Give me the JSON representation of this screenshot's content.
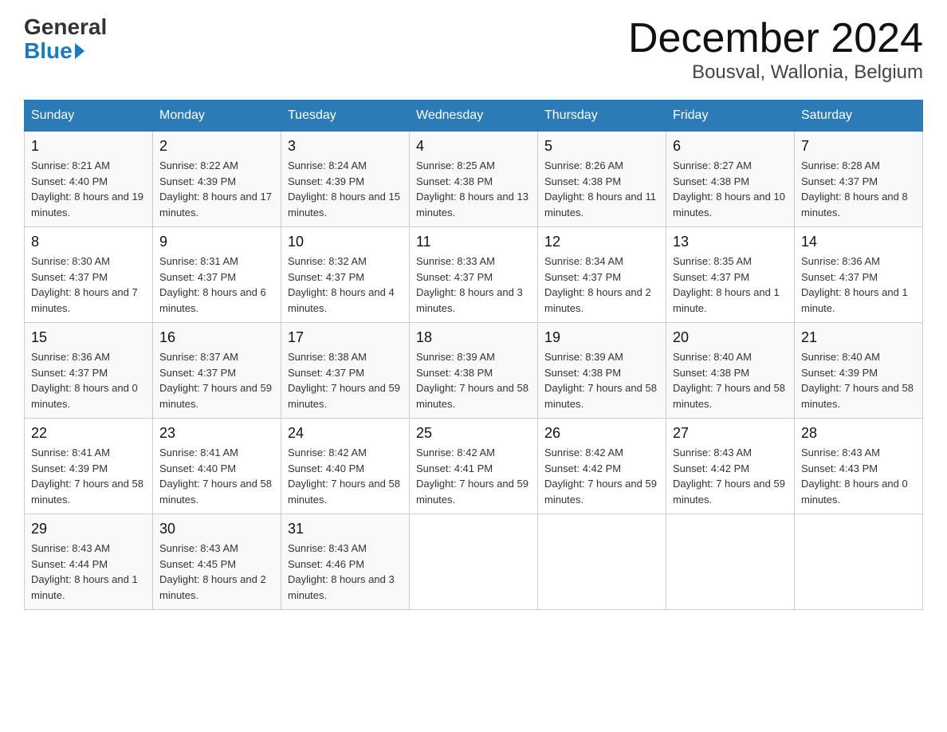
{
  "logo": {
    "general": "General",
    "blue": "Blue"
  },
  "header": {
    "month": "December 2024",
    "location": "Bousval, Wallonia, Belgium"
  },
  "days_of_week": [
    "Sunday",
    "Monday",
    "Tuesday",
    "Wednesday",
    "Thursday",
    "Friday",
    "Saturday"
  ],
  "weeks": [
    [
      {
        "day": "1",
        "sunrise": "8:21 AM",
        "sunset": "4:40 PM",
        "daylight": "8 hours and 19 minutes."
      },
      {
        "day": "2",
        "sunrise": "8:22 AM",
        "sunset": "4:39 PM",
        "daylight": "8 hours and 17 minutes."
      },
      {
        "day": "3",
        "sunrise": "8:24 AM",
        "sunset": "4:39 PM",
        "daylight": "8 hours and 15 minutes."
      },
      {
        "day": "4",
        "sunrise": "8:25 AM",
        "sunset": "4:38 PM",
        "daylight": "8 hours and 13 minutes."
      },
      {
        "day": "5",
        "sunrise": "8:26 AM",
        "sunset": "4:38 PM",
        "daylight": "8 hours and 11 minutes."
      },
      {
        "day": "6",
        "sunrise": "8:27 AM",
        "sunset": "4:38 PM",
        "daylight": "8 hours and 10 minutes."
      },
      {
        "day": "7",
        "sunrise": "8:28 AM",
        "sunset": "4:37 PM",
        "daylight": "8 hours and 8 minutes."
      }
    ],
    [
      {
        "day": "8",
        "sunrise": "8:30 AM",
        "sunset": "4:37 PM",
        "daylight": "8 hours and 7 minutes."
      },
      {
        "day": "9",
        "sunrise": "8:31 AM",
        "sunset": "4:37 PM",
        "daylight": "8 hours and 6 minutes."
      },
      {
        "day": "10",
        "sunrise": "8:32 AM",
        "sunset": "4:37 PM",
        "daylight": "8 hours and 4 minutes."
      },
      {
        "day": "11",
        "sunrise": "8:33 AM",
        "sunset": "4:37 PM",
        "daylight": "8 hours and 3 minutes."
      },
      {
        "day": "12",
        "sunrise": "8:34 AM",
        "sunset": "4:37 PM",
        "daylight": "8 hours and 2 minutes."
      },
      {
        "day": "13",
        "sunrise": "8:35 AM",
        "sunset": "4:37 PM",
        "daylight": "8 hours and 1 minute."
      },
      {
        "day": "14",
        "sunrise": "8:36 AM",
        "sunset": "4:37 PM",
        "daylight": "8 hours and 1 minute."
      }
    ],
    [
      {
        "day": "15",
        "sunrise": "8:36 AM",
        "sunset": "4:37 PM",
        "daylight": "8 hours and 0 minutes."
      },
      {
        "day": "16",
        "sunrise": "8:37 AM",
        "sunset": "4:37 PM",
        "daylight": "7 hours and 59 minutes."
      },
      {
        "day": "17",
        "sunrise": "8:38 AM",
        "sunset": "4:37 PM",
        "daylight": "7 hours and 59 minutes."
      },
      {
        "day": "18",
        "sunrise": "8:39 AM",
        "sunset": "4:38 PM",
        "daylight": "7 hours and 58 minutes."
      },
      {
        "day": "19",
        "sunrise": "8:39 AM",
        "sunset": "4:38 PM",
        "daylight": "7 hours and 58 minutes."
      },
      {
        "day": "20",
        "sunrise": "8:40 AM",
        "sunset": "4:38 PM",
        "daylight": "7 hours and 58 minutes."
      },
      {
        "day": "21",
        "sunrise": "8:40 AM",
        "sunset": "4:39 PM",
        "daylight": "7 hours and 58 minutes."
      }
    ],
    [
      {
        "day": "22",
        "sunrise": "8:41 AM",
        "sunset": "4:39 PM",
        "daylight": "7 hours and 58 minutes."
      },
      {
        "day": "23",
        "sunrise": "8:41 AM",
        "sunset": "4:40 PM",
        "daylight": "7 hours and 58 minutes."
      },
      {
        "day": "24",
        "sunrise": "8:42 AM",
        "sunset": "4:40 PM",
        "daylight": "7 hours and 58 minutes."
      },
      {
        "day": "25",
        "sunrise": "8:42 AM",
        "sunset": "4:41 PM",
        "daylight": "7 hours and 59 minutes."
      },
      {
        "day": "26",
        "sunrise": "8:42 AM",
        "sunset": "4:42 PM",
        "daylight": "7 hours and 59 minutes."
      },
      {
        "day": "27",
        "sunrise": "8:43 AM",
        "sunset": "4:42 PM",
        "daylight": "7 hours and 59 minutes."
      },
      {
        "day": "28",
        "sunrise": "8:43 AM",
        "sunset": "4:43 PM",
        "daylight": "8 hours and 0 minutes."
      }
    ],
    [
      {
        "day": "29",
        "sunrise": "8:43 AM",
        "sunset": "4:44 PM",
        "daylight": "8 hours and 1 minute."
      },
      {
        "day": "30",
        "sunrise": "8:43 AM",
        "sunset": "4:45 PM",
        "daylight": "8 hours and 2 minutes."
      },
      {
        "day": "31",
        "sunrise": "8:43 AM",
        "sunset": "4:46 PM",
        "daylight": "8 hours and 3 minutes."
      },
      null,
      null,
      null,
      null
    ]
  ],
  "labels": {
    "sunrise": "Sunrise:",
    "sunset": "Sunset:",
    "daylight": "Daylight:"
  }
}
